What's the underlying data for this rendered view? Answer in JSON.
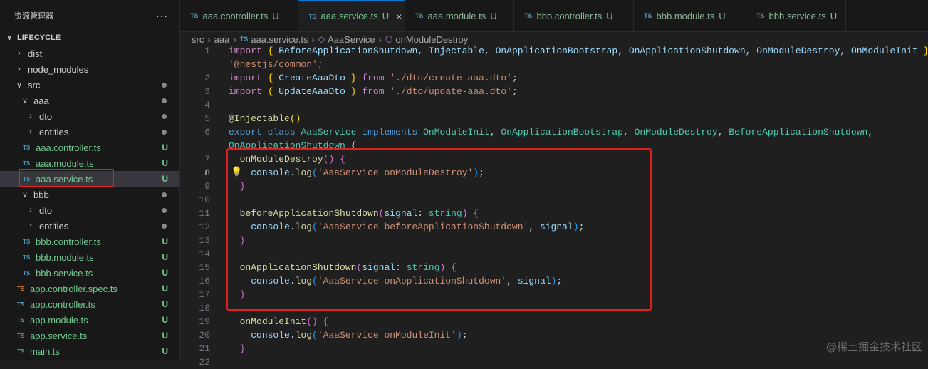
{
  "explorer": {
    "title": "资源管理器",
    "more": "···",
    "section": "LIFECYCLE",
    "items": [
      {
        "label": "dist",
        "kind": "folder",
        "open": false,
        "depth": 1,
        "status": ""
      },
      {
        "label": "node_modules",
        "kind": "folder",
        "open": false,
        "depth": 1,
        "status": ""
      },
      {
        "label": "src",
        "kind": "folder",
        "open": true,
        "depth": 1,
        "status": "dot"
      },
      {
        "label": "aaa",
        "kind": "folder",
        "open": true,
        "depth": 2,
        "status": "dot"
      },
      {
        "label": "dto",
        "kind": "folder",
        "open": false,
        "depth": 3,
        "status": "dot"
      },
      {
        "label": "entities",
        "kind": "folder",
        "open": false,
        "depth": 3,
        "status": "dot"
      },
      {
        "label": "aaa.controller.ts",
        "kind": "ts",
        "depth": 3,
        "status": "U"
      },
      {
        "label": "aaa.module.ts",
        "kind": "ts",
        "depth": 3,
        "status": "U"
      },
      {
        "label": "aaa.service.ts",
        "kind": "ts",
        "depth": 3,
        "status": "U",
        "selected": true
      },
      {
        "label": "bbb",
        "kind": "folder",
        "open": true,
        "depth": 2,
        "status": "dot"
      },
      {
        "label": "dto",
        "kind": "folder",
        "open": false,
        "depth": 3,
        "status": "dot"
      },
      {
        "label": "entities",
        "kind": "folder",
        "open": false,
        "depth": 3,
        "status": "dot"
      },
      {
        "label": "bbb.controller.ts",
        "kind": "ts",
        "depth": 3,
        "status": "U"
      },
      {
        "label": "bbb.module.ts",
        "kind": "ts",
        "depth": 3,
        "status": "U"
      },
      {
        "label": "bbb.service.ts",
        "kind": "ts",
        "depth": 3,
        "status": "U"
      },
      {
        "label": "app.controller.spec.ts",
        "kind": "spec",
        "depth": 2,
        "status": "U"
      },
      {
        "label": "app.controller.ts",
        "kind": "ts",
        "depth": 2,
        "status": "U"
      },
      {
        "label": "app.module.ts",
        "kind": "ts",
        "depth": 2,
        "status": "U"
      },
      {
        "label": "app.service.ts",
        "kind": "ts",
        "depth": 2,
        "status": "U"
      },
      {
        "label": "main.ts",
        "kind": "ts",
        "depth": 2,
        "status": "U"
      }
    ]
  },
  "tabs": [
    {
      "icon": "TS",
      "name": "aaa.controller.ts",
      "status": "U",
      "active": false
    },
    {
      "icon": "TS",
      "name": "aaa.service.ts",
      "status": "U",
      "active": true
    },
    {
      "icon": "TS",
      "name": "aaa.module.ts",
      "status": "U",
      "active": false
    },
    {
      "icon": "TS",
      "name": "bbb.controller.ts",
      "status": "U",
      "active": false
    },
    {
      "icon": "TS",
      "name": "bbb.module.ts",
      "status": "U",
      "active": false
    },
    {
      "icon": "TS",
      "name": "bbb.service.ts",
      "status": "U",
      "active": false
    }
  ],
  "breadcrumb": {
    "parts": [
      "src",
      "aaa",
      "aaa.service.ts",
      "AaaService",
      "onModuleDestroy"
    ],
    "ts_icon": "TS"
  },
  "editor": {
    "active_line": "8",
    "lines": [
      {
        "n": "1",
        "html": "<span class='k'>import</span> <span class='br'>{</span> <span class='v'>BeforeApplicationShutdown</span><span class='p'>,</span> <span class='v'>Injectable</span><span class='p'>,</span> <span class='v'>OnApplicationBootstrap</span><span class='p'>,</span> <span class='v'>OnApplicationShutdown</span><span class='p'>,</span> <span class='v'>OnModuleDestroy</span><span class='p'>,</span> <span class='v'>OnModuleInit</span> <span class='br'>}</span> <span class='k'>from</span>"
      },
      {
        "n": "",
        "html": "<span class='s'>'@nestjs/common'</span><span class='p'>;</span>"
      },
      {
        "n": "2",
        "html": "<span class='k'>import</span> <span class='br'>{</span> <span class='v'>CreateAaaDto</span> <span class='br'>}</span> <span class='k'>from</span> <span class='s'>'./dto/create-aaa.dto'</span><span class='p'>;</span>"
      },
      {
        "n": "3",
        "html": "<span class='k'>import</span> <span class='br'>{</span> <span class='v'>UpdateAaaDto</span> <span class='br'>}</span> <span class='k'>from</span> <span class='s'>'./dto/update-aaa.dto'</span><span class='p'>;</span>"
      },
      {
        "n": "4",
        "html": ""
      },
      {
        "n": "5",
        "html": "<span class='dec'>@Injectable</span><span class='br'>()</span>"
      },
      {
        "n": "6",
        "html": "<span class='kw'>export</span> <span class='kw'>class</span> <span class='t'>AaaService</span> <span class='kw'>implements</span> <span class='t'>OnModuleInit</span><span class='p'>,</span> <span class='t'>OnApplicationBootstrap</span><span class='p'>,</span> <span class='t'>OnModuleDestroy</span><span class='p'>,</span> <span class='t'>BeforeApplicationShutdown</span><span class='p'>,</span>"
      },
      {
        "n": "",
        "html": "<span class='t'>OnApplicationShutdown</span> <span class='br'>{</span>"
      },
      {
        "n": "7",
        "html": "  <span class='f'>onModuleDestroy</span><span class='br2'>()</span> <span class='br2'>{</span>"
      },
      {
        "n": "8",
        "html": "    <span class='v'>console</span><span class='p'>.</span><span class='f'>log</span><span class='br3'>(</span><span class='s'>'AaaService onModuleDestroy'</span><span class='br3'>)</span><span class='p'>;</span>"
      },
      {
        "n": "9",
        "html": "  <span class='br2'>}</span>"
      },
      {
        "n": "10",
        "html": ""
      },
      {
        "n": "11",
        "html": "  <span class='f'>beforeApplicationShutdown</span><span class='br2'>(</span><span class='v'>signal</span><span class='p'>:</span> <span class='t'>string</span><span class='br2'>)</span> <span class='br2'>{</span>"
      },
      {
        "n": "12",
        "html": "    <span class='v'>console</span><span class='p'>.</span><span class='f'>log</span><span class='br3'>(</span><span class='s'>'AaaService beforeApplicationShutdown'</span><span class='p'>,</span> <span class='v'>signal</span><span class='br3'>)</span><span class='p'>;</span>"
      },
      {
        "n": "13",
        "html": "  <span class='br2'>}</span>"
      },
      {
        "n": "14",
        "html": ""
      },
      {
        "n": "15",
        "html": "  <span class='f'>onApplicationShutdown</span><span class='br2'>(</span><span class='v'>signal</span><span class='p'>:</span> <span class='t'>string</span><span class='br2'>)</span> <span class='br2'>{</span>"
      },
      {
        "n": "16",
        "html": "    <span class='v'>console</span><span class='p'>.</span><span class='f'>log</span><span class='br3'>(</span><span class='s'>'AaaService onApplicationShutdown'</span><span class='p'>,</span> <span class='v'>signal</span><span class='br3'>)</span><span class='p'>;</span>"
      },
      {
        "n": "17",
        "html": "  <span class='br2'>}</span>"
      },
      {
        "n": "18",
        "html": ""
      },
      {
        "n": "19",
        "html": "  <span class='f'>onModuleInit</span><span class='br2'>()</span> <span class='br2'>{</span>"
      },
      {
        "n": "20",
        "html": "    <span class='v'>console</span><span class='p'>.</span><span class='f'>log</span><span class='br3'>(</span><span class='s'>'AaaService onModuleInit'</span><span class='br3'>)</span><span class='p'>;</span>"
      },
      {
        "n": "21",
        "html": "  <span class='br2'>}</span>"
      },
      {
        "n": "22",
        "html": ""
      }
    ]
  },
  "watermark": "@稀土掘金技术社区",
  "colors": {
    "accent": "#0078d4",
    "modified": "#73c991",
    "annotation": "#e02020"
  }
}
